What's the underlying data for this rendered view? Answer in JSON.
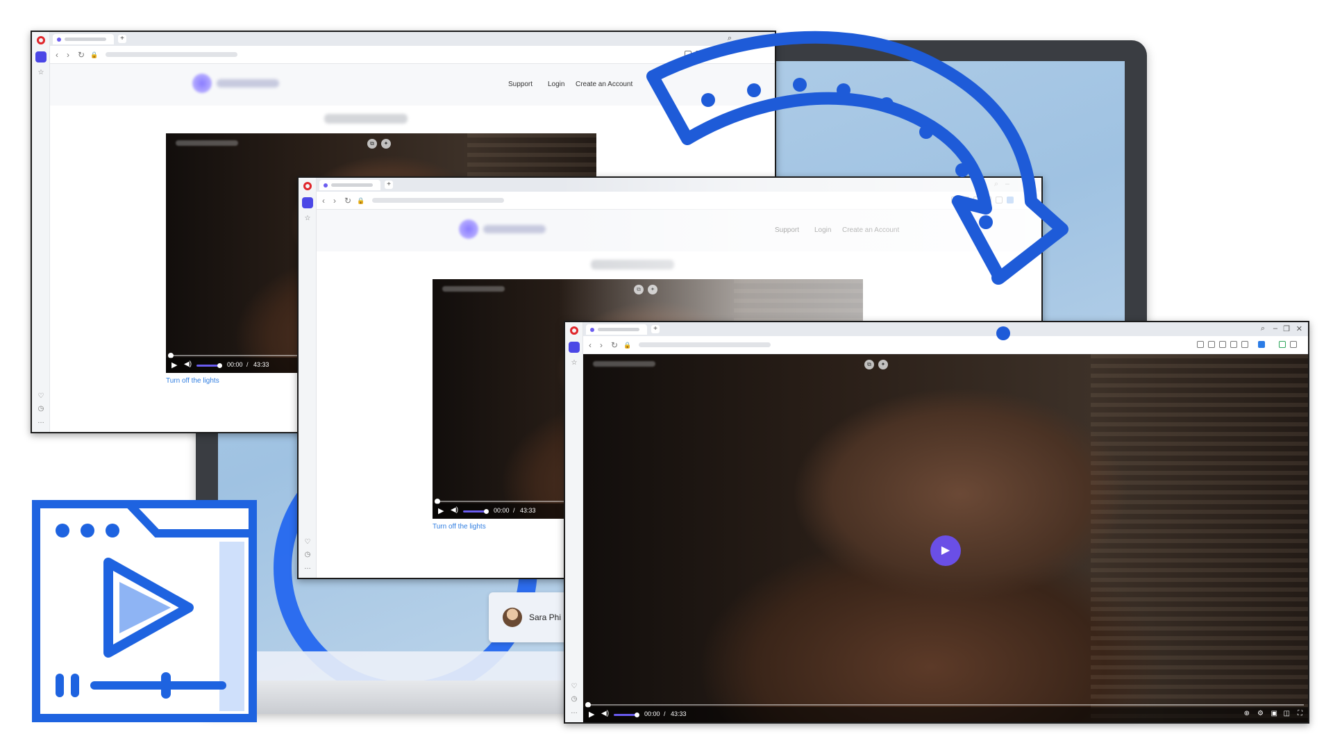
{
  "site_nav": {
    "support": "Support",
    "login": "Login",
    "create_account": "Create an Account"
  },
  "player": {
    "current_time": "00:00",
    "separator": "/",
    "duration": "43:33",
    "progress": 0,
    "volume": 0.7
  },
  "page": {
    "lights_link": "Turn off the lights"
  },
  "desktop": {
    "user_name": "Sara Phi"
  },
  "colors": {
    "accent": "#6a4fe6",
    "arrow": "#1e5bd8",
    "badge": "#1e63e0",
    "opera_red": "#e0262b",
    "link": "#2f7de1"
  },
  "icons": {
    "browser": "opera-icon",
    "play": "play-icon",
    "volume": "volume-icon",
    "pip": "picture-in-picture-icon",
    "sparkle": "sparkle-icon",
    "fullscreen": "fullscreen-icon",
    "settings": "gear-icon",
    "cast": "cast-icon",
    "zoom": "zoom-icon",
    "arrow": "curved-arrow-icon",
    "badge": "video-player-window-icon"
  }
}
